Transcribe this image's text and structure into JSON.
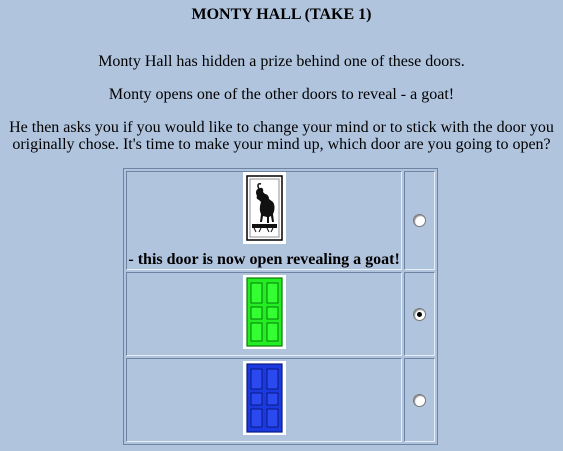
{
  "page": {
    "title": "MONTY HALL (TAKE 1)",
    "intro_1": "Monty Hall has hidden a prize behind one of these doors.",
    "intro_2": "Monty opens one of the other doors to reveal - a goat!",
    "intro_3": "He then asks you if you would like to change your mind or to stick with the door you originally chose. It's time to make your mind up, which door are you going to open?"
  },
  "doors": [
    {
      "state": "open-goat",
      "caption": "- this door is now open revealing a goat!",
      "selected": false,
      "color": "#ffffff",
      "icon": "goat-door-icon"
    },
    {
      "state": "closed",
      "caption": "",
      "selected": true,
      "color": "#22ee22",
      "icon": "green-door-icon"
    },
    {
      "state": "closed",
      "caption": "",
      "selected": false,
      "color": "#1a3adf",
      "icon": "blue-door-icon"
    }
  ],
  "colors": {
    "background": "#b0c4de",
    "green_door": "#22ee22",
    "blue_door": "#1a3adf"
  }
}
